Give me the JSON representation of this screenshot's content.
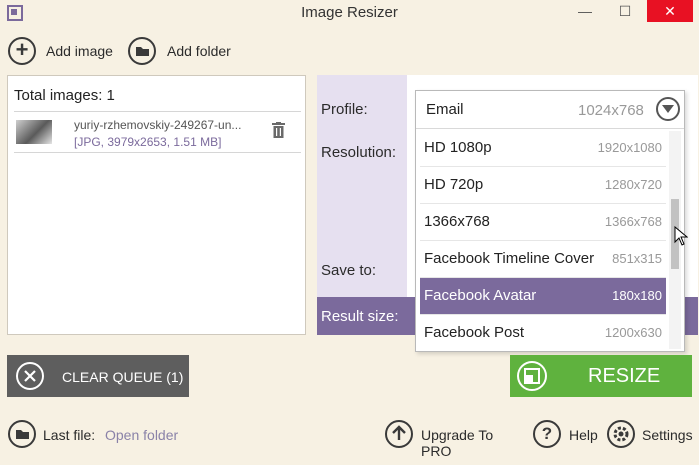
{
  "window": {
    "title": "Image Resizer",
    "minimize": "—",
    "maximize": "☐",
    "close": "✕"
  },
  "toolbar": {
    "add_image": "Add image",
    "add_folder": "Add folder"
  },
  "images": {
    "total_label": "Total images: 1",
    "items": [
      {
        "name": "yuriy-rzhemovskiy-249267-un...",
        "meta": "[JPG, 3979x2653, 1.51 MB]"
      }
    ]
  },
  "settings": {
    "profile_label": "Profile:",
    "resolution_label": "Resolution:",
    "save_to_label": "Save to:",
    "result_size_label": "Result size:"
  },
  "profile_dropdown": {
    "selected_name": "Email",
    "selected_size": "1024x768",
    "options": [
      {
        "name": "HD 1080p",
        "size": "1920x1080"
      },
      {
        "name": "HD 720p",
        "size": "1280x720"
      },
      {
        "name": "1366x768",
        "size": "1366x768"
      },
      {
        "name": "Facebook Timeline Cover",
        "size": "851x315"
      },
      {
        "name": "Facebook Avatar",
        "size": "180x180"
      },
      {
        "name": "Facebook Post",
        "size": "1200x630"
      }
    ],
    "highlighted_index": 4
  },
  "actions": {
    "clear_queue": "CLEAR QUEUE (1)",
    "resize": "RESIZE"
  },
  "footer": {
    "last_file_label": "Last file:",
    "open_folder": "Open folder",
    "upgrade": "Upgrade To PRO",
    "help": "Help",
    "settings": "Settings"
  },
  "colors": {
    "accent": "#7b6a9c",
    "resize_green": "#5fb23e",
    "clear_gray": "#5e5e5e",
    "background": "#f7f1e3"
  }
}
